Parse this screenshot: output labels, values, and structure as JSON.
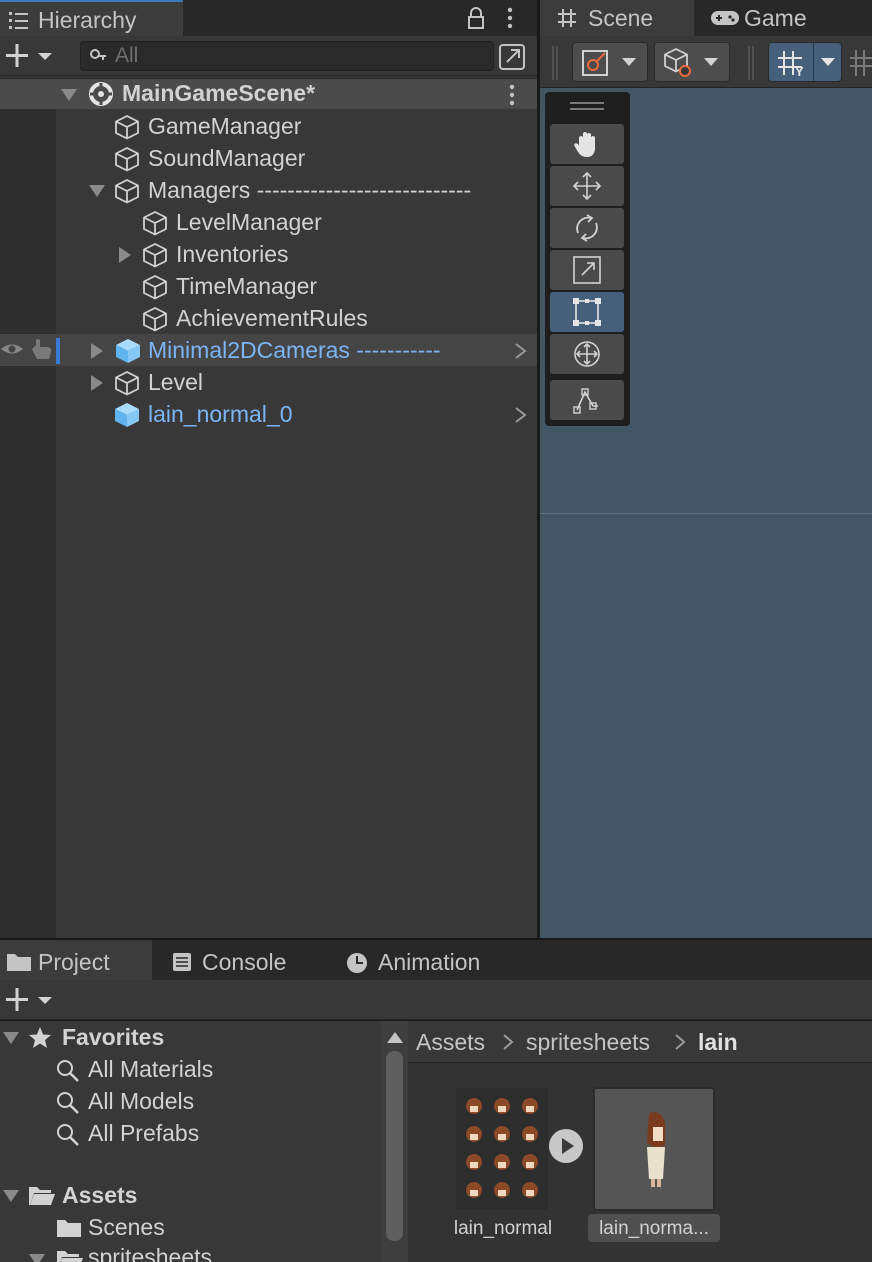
{
  "hierarchy": {
    "tab_label": "Hierarchy",
    "search_placeholder": "All",
    "scene_name": "MainGameScene*",
    "items": [
      {
        "label": "GameManager"
      },
      {
        "label": "SoundManager"
      },
      {
        "label": "Managers ----------------------------"
      },
      {
        "label": "LevelManager"
      },
      {
        "label": "Inventories"
      },
      {
        "label": "TimeManager"
      },
      {
        "label": "AchievementRules"
      },
      {
        "label": "Minimal2DCameras -----------"
      },
      {
        "label": "Level"
      },
      {
        "label": "lain_normal_0"
      }
    ]
  },
  "scene_view": {
    "tabs": [
      {
        "label": "Scene"
      },
      {
        "label": "Game"
      }
    ],
    "tools": [
      "hand-tool",
      "move-tool",
      "rotate-tool",
      "scale-tool",
      "rect-tool",
      "transform-tool",
      "custom-tool"
    ],
    "active_tool": "rect-tool"
  },
  "project": {
    "tabs": [
      {
        "label": "Project"
      },
      {
        "label": "Console"
      },
      {
        "label": "Animation"
      }
    ],
    "favorites_label": "Favorites",
    "favorites": [
      {
        "label": "All Materials"
      },
      {
        "label": "All Models"
      },
      {
        "label": "All Prefabs"
      }
    ],
    "assets_label": "Assets",
    "folders": [
      {
        "label": "Scenes"
      },
      {
        "label": "spritesheets"
      }
    ],
    "breadcrumb": [
      "Assets",
      "spritesheets",
      "lain"
    ],
    "assets": [
      {
        "label": "lain_normal"
      },
      {
        "label": "lain_norma..."
      }
    ]
  },
  "colors": {
    "accent": "#3a79bb",
    "prefab_text": "#7cb4f4",
    "scene_background": "#435664",
    "active_tool": "#46607c"
  }
}
